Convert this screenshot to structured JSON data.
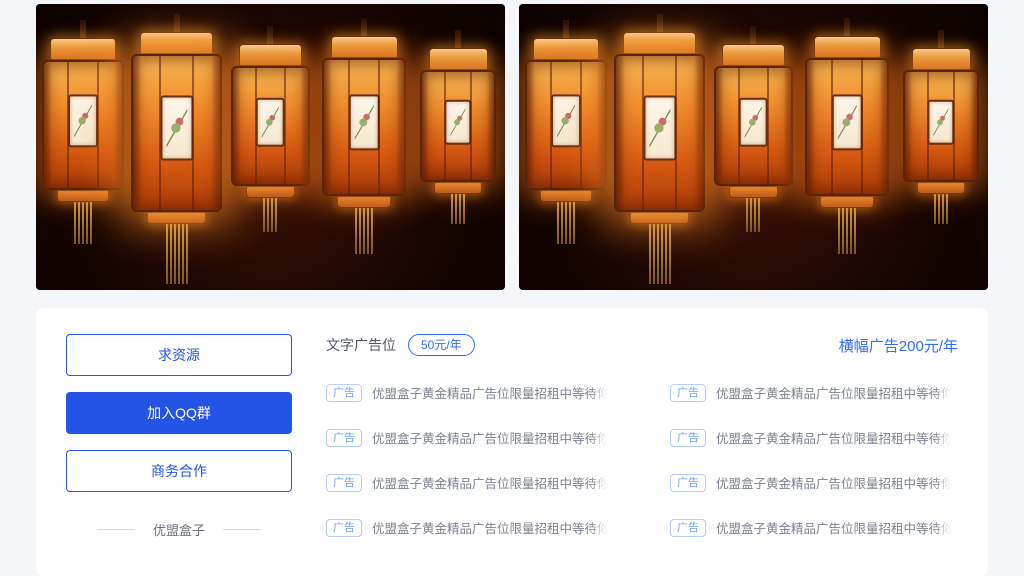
{
  "banners": [
    {
      "name": "banner-image-1",
      "alt": "横幅广告图1"
    },
    {
      "name": "banner-image-2",
      "alt": "横幅广告图2"
    }
  ],
  "sidebar": {
    "buttons": [
      {
        "label": "求资源",
        "style": "outline"
      },
      {
        "label": "加入QQ群",
        "style": "filled"
      },
      {
        "label": "商务合作",
        "style": "outline"
      }
    ],
    "divider_label": "优盟盒子"
  },
  "main": {
    "text_ad_title": "文字广告位",
    "text_ad_price": "50元/年",
    "banner_ad_price": "横幅广告200元/年",
    "ad_tag": "广告",
    "ads": [
      "优盟盒子黄金精品广告位限量招租中等待你的加入",
      "优盟盒子黄金精品广告位限量招租中等待你的加入",
      "优盟盒子黄金精品广告位限量招租中等待你的加入",
      "优盟盒子黄金精品广告位限量招租中等待你的加入",
      "优盟盒子黄金精品广告位限量招租中等待你的加入",
      "优盟盒子黄金精品广告位限量招租中等待你的加入",
      "优盟盒子黄金精品广告位限量招租中等待你的加入",
      "优盟盒子黄金精品广告位限量招租中等待你的加入"
    ]
  }
}
